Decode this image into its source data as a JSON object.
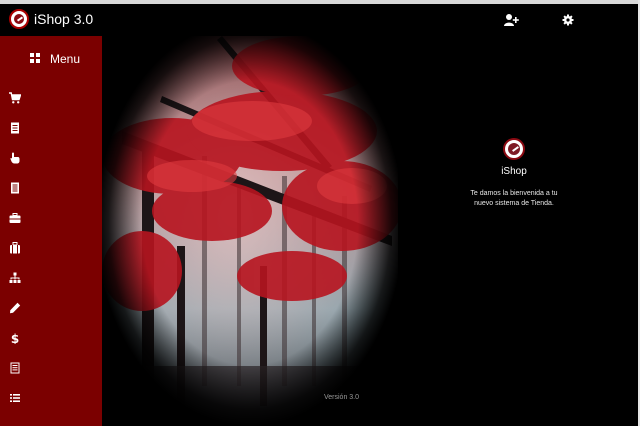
{
  "app": {
    "title": "iShop 3.0"
  },
  "header": {
    "icons": {
      "user_add": "user-add-icon",
      "settings": "gear-icon"
    }
  },
  "sidebar": {
    "menu_label": "Menu",
    "menu_icon": "grid-icon",
    "items": [
      {
        "icon": "cart-icon"
      },
      {
        "icon": "document-icon"
      },
      {
        "icon": "hand-pointer-icon"
      },
      {
        "icon": "list-document-icon"
      },
      {
        "icon": "briefcase-icon"
      },
      {
        "icon": "suitcase-icon"
      },
      {
        "icon": "sitemap-icon"
      },
      {
        "icon": "pencil-icon"
      },
      {
        "icon": "dollar-icon"
      },
      {
        "icon": "report-icon"
      },
      {
        "icon": "list-icon"
      }
    ]
  },
  "hero": {
    "version": "Versión 3.0"
  },
  "welcome": {
    "name": "iShop",
    "line1": "Te damos la bienvenida a tu",
    "line2": "nuevo sistema de Tienda."
  },
  "colors": {
    "sidebar": "#7b0000",
    "background": "#000000",
    "accent": "#8b0a12"
  }
}
